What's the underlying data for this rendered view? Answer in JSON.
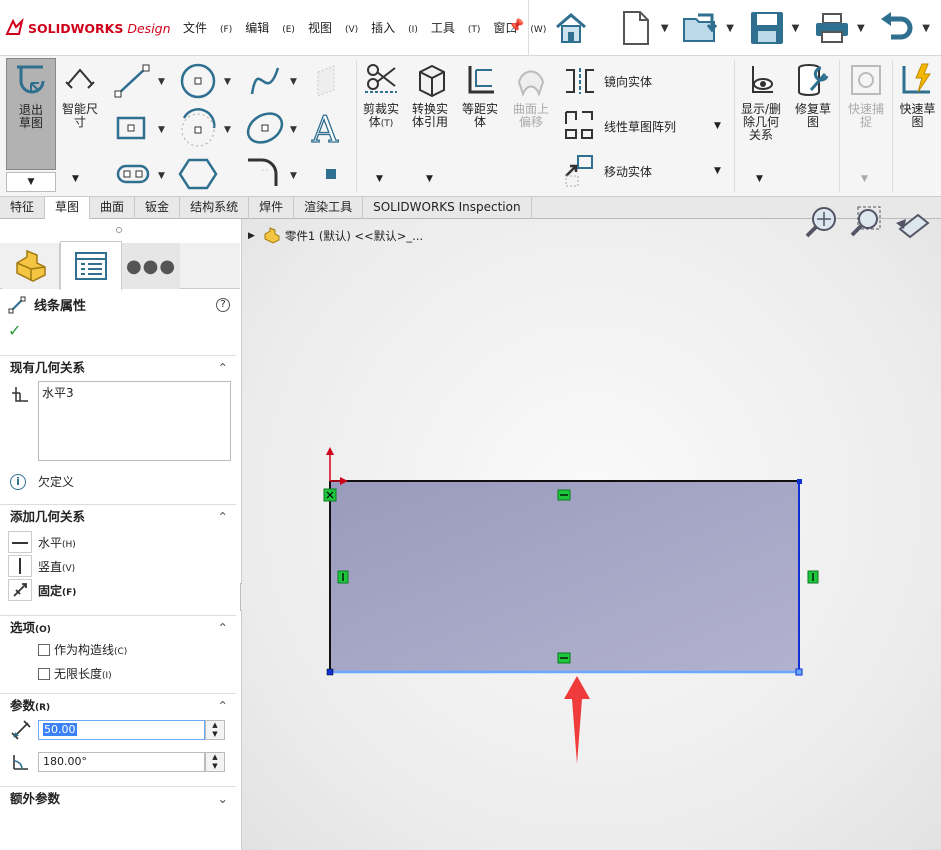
{
  "app": {
    "logo_ds": "DS",
    "logo_brand": "SOLIDWORKS",
    "logo_suffix": "Design"
  },
  "menus": [
    {
      "label": "文件",
      "key": "(F)"
    },
    {
      "label": "编辑",
      "key": "(E)"
    },
    {
      "label": "视图",
      "key": "(V)"
    },
    {
      "label": "插入",
      "key": "(I)"
    },
    {
      "label": "工具",
      "key": "(T)"
    },
    {
      "label": "窗口",
      "key": "(W)"
    }
  ],
  "ribbon": {
    "exit_sketch": "退出草图",
    "smart_dim": "智能尺寸",
    "trim": "剪裁实体",
    "trim_key": "(T)",
    "convert": "转换实体引用",
    "offset": "等距实体",
    "surface_offset": "曲面上偏移",
    "mirror": "镜向实体",
    "linear_pattern": "线性草图阵列",
    "move": "移动实体",
    "display_relations": "显示/删除几何关系",
    "repair": "修复草图",
    "quick_snap": "快速捕捉",
    "rapid_sketch": "快速草图"
  },
  "tabs": [
    "特征",
    "草图",
    "曲面",
    "钣金",
    "结构系统",
    "焊件",
    "渲染工具",
    "SOLIDWORKS Inspection"
  ],
  "active_tab": "草图",
  "tree": {
    "part": "零件1 (默认) <<默认>_..."
  },
  "panel": {
    "title": "线条属性",
    "existing_relations": "现有几何关系",
    "relation_item": "水平3",
    "status": "欠定义",
    "add_relations": "添加几何关系",
    "horizontal": "水平",
    "horizontal_key": "(H)",
    "vertical": "竖直",
    "vertical_key": "(V)",
    "fix": "固定",
    "fix_key": "(F)",
    "options": "选项",
    "options_key": "(O)",
    "construction": "作为构造线",
    "construction_key": "(C)",
    "infinite": "无限长度",
    "infinite_key": "(I)",
    "params": "参数",
    "params_key": "(R)",
    "length": "50.00",
    "angle": "180.00°",
    "extra_params": "额外参数"
  },
  "colors": {
    "accent": "#d0021b",
    "sketch_fill": "#a6a6c8",
    "relation_green": "#22c55e",
    "selected_line": "#6aa7ff"
  }
}
